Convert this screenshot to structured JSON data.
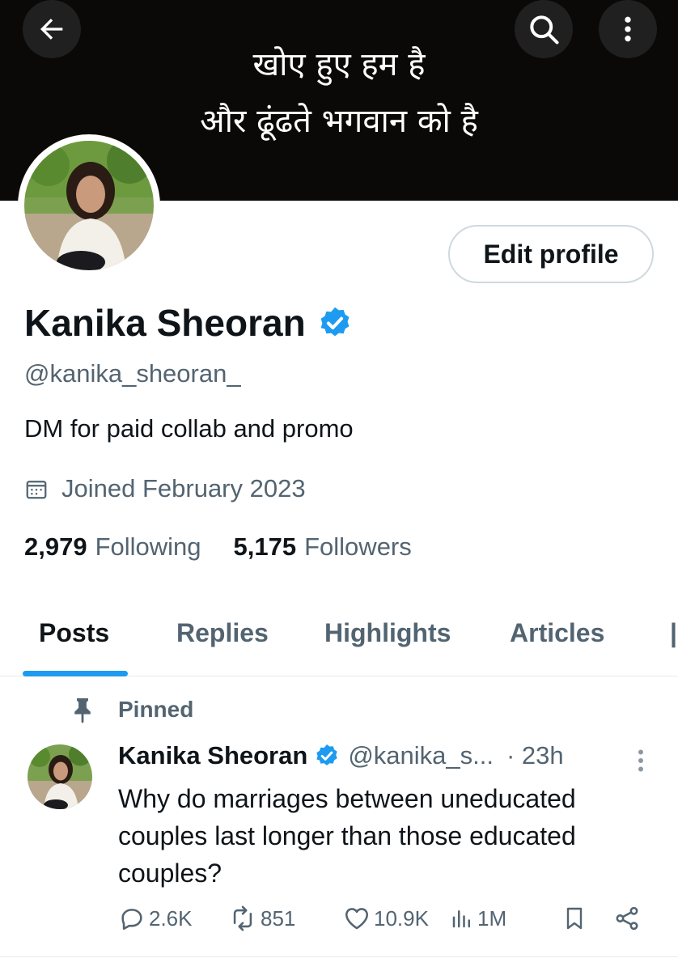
{
  "header": {
    "banner_line_1": "खोए हुए हम है",
    "banner_line_2": "और ढूंढते भगवान को है",
    "back_icon": "arrow-left-icon",
    "search_icon": "search-icon",
    "more_icon": "more-vertical-icon"
  },
  "profile": {
    "display_name": "Kanika Sheoran",
    "verified": true,
    "handle": "@kanika_sheoran_",
    "bio": "DM for paid collab and promo",
    "joined": "Joined February 2023",
    "following_count": "2,979",
    "following_label": "Following",
    "followers_count": "5,175",
    "followers_label": "Followers",
    "edit_profile_label": "Edit profile"
  },
  "tabs": [
    {
      "label": "Posts",
      "active": true
    },
    {
      "label": "Replies",
      "active": false
    },
    {
      "label": "Highlights",
      "active": false
    },
    {
      "label": "Articles",
      "active": false
    }
  ],
  "pinned_post": {
    "pinned_label": "Pinned",
    "author_name": "Kanika Sheoran",
    "author_handle": "@kanika_s...",
    "time": "· 23h",
    "text": "Why do marriages between uneducated couples last longer than those educated couples?",
    "replies": "2.6K",
    "reposts": "851",
    "likes": "10.9K",
    "views": "1M"
  },
  "colors": {
    "accent": "#1d9bf0",
    "text_primary": "#0f1419",
    "text_secondary": "#536471",
    "banner_bg": "#0b0808"
  }
}
